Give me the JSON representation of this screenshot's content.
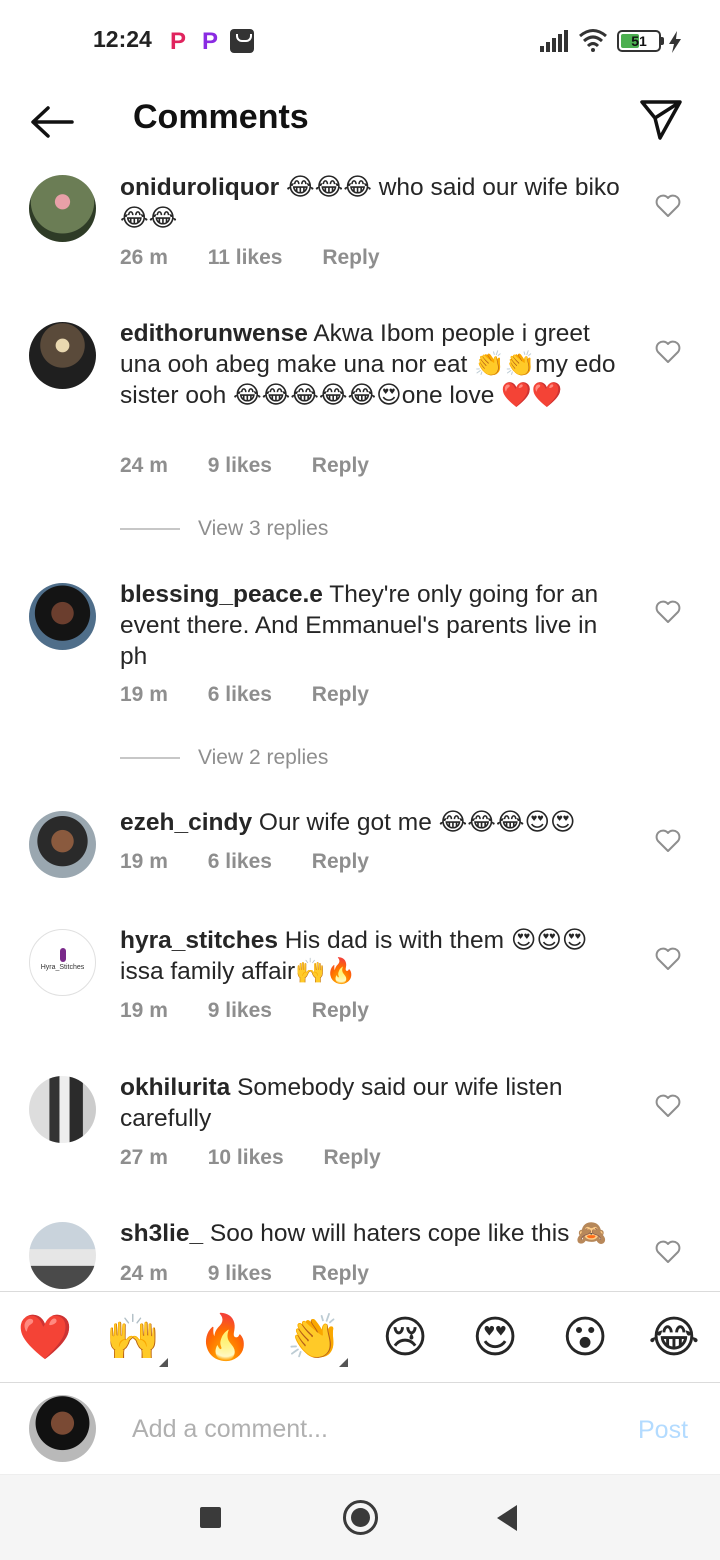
{
  "status_bar": {
    "time": "12:24",
    "battery": "51",
    "battery_level": 0.51,
    "icons": [
      "picsart-icon",
      "picsart-icon",
      "shopping-bag-icon",
      "signal-icon",
      "wifi-icon",
      "battery-icon",
      "charging-bolt-icon"
    ]
  },
  "header": {
    "title": "Comments",
    "back_icon": "arrow-left-icon",
    "share_icon": "paper-plane-icon"
  },
  "comments": [
    {
      "username": "oniduroliquor",
      "text": "😂😂😂 who said our wife biko😂😂",
      "time": "26 m",
      "likes": "11 likes",
      "reply": "Reply"
    },
    {
      "username": "edithorunwense",
      "text": "Akwa Ibom people i greet una ooh abeg make una nor eat 👏👏my edo sister ooh 😂😂😂😂😂😍one love ❤️❤️",
      "time": "24 m",
      "likes": "9 likes",
      "reply": "Reply",
      "view_replies": "View 3 replies"
    },
    {
      "username": "blessing_peace.e",
      "text": "They're only going for an event there. And Emmanuel's parents live in ph",
      "time": "19 m",
      "likes": "6 likes",
      "reply": "Reply",
      "view_replies": "View 2 replies"
    },
    {
      "username": "ezeh_cindy",
      "text": "Our wife got me 😂😂😂😍😍",
      "time": "19 m",
      "likes": "6 likes",
      "reply": "Reply"
    },
    {
      "username": "hyra_stitches",
      "text": "His dad is with them 😍😍😍 issa family affair🙌🔥",
      "time": "19 m",
      "likes": "9 likes",
      "reply": "Reply",
      "avatar_text": "Hyra_Stitches"
    },
    {
      "username": "okhilurita",
      "text": "Somebody said our wife listen carefully",
      "time": "27 m",
      "likes": "10 likes",
      "reply": "Reply"
    },
    {
      "username": "sh3lie_",
      "text": "Soo how will haters cope like this 🙈",
      "time": "24 m",
      "likes": "9 likes",
      "reply": "Reply"
    }
  ],
  "emoji_bar": [
    "❤️",
    "🙌",
    "🔥",
    "👏",
    "😢",
    "😍",
    "😮",
    "😂"
  ],
  "composer": {
    "placeholder": "Add a comment...",
    "post_label": "Post"
  },
  "colors": {
    "accent_disabled": "#b3dbff",
    "meta_text": "#8e8e8e",
    "text": "#262626"
  }
}
